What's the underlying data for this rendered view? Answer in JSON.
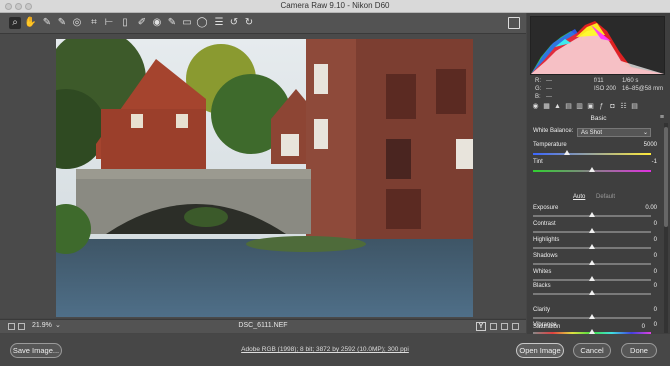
{
  "window": {
    "title": "Camera Raw 9.10  -  Nikon D60"
  },
  "toolbar": {
    "tools": [
      "zoom-tool-icon",
      "hand-tool-icon",
      "white-balance-tool-icon",
      "color-sampler-icon",
      "targeted-adjustment-icon",
      "crop-tool-icon",
      "straighten-tool-icon",
      "spot-removal-icon",
      "red-eye-icon",
      "adjustment-brush-icon",
      "graduated-filter-icon",
      "radial-filter-icon",
      "preferences-icon",
      "rotate-left-icon",
      "rotate-right-icon"
    ],
    "glyphs": [
      "⌕",
      "✋",
      "✎",
      "✎",
      "◎",
      "⌗",
      "⊢",
      "✐",
      "◉",
      "✎",
      "▭",
      "◯",
      "☰",
      "↺",
      "↻"
    ]
  },
  "histogram": {
    "colors": {
      "red": "#ff2020",
      "green": "#30ff30",
      "blue": "#3060ff",
      "yellow": "#ffff20",
      "magenta": "#ff30ff",
      "cyan": "#30ffff",
      "white": "#ffffff"
    }
  },
  "readout": {
    "r_label": "R:",
    "g_label": "G:",
    "b_label": "B:",
    "r_val": "---",
    "g_val": "---",
    "b_val": "---",
    "aperture": "f/11",
    "shutter": "1/60 s",
    "iso": "ISO 200",
    "lens": "16–85@58 mm"
  },
  "panel": {
    "title": "Basic",
    "wb_label": "White Balance:",
    "wb_value": "As Shot",
    "temperature_label": "Temperature",
    "temperature_value": "5000",
    "tint_label": "Tint",
    "tint_value": "-1",
    "auto_label": "Auto",
    "default_label": "Default",
    "exposure_label": "Exposure",
    "exposure_value": "0.00",
    "contrast_label": "Contrast",
    "contrast_value": "0",
    "highlights_label": "Highlights",
    "highlights_value": "0",
    "shadows_label": "Shadows",
    "shadows_value": "0",
    "whites_label": "Whites",
    "whites_value": "0",
    "blacks_label": "Blacks",
    "blacks_value": "0",
    "clarity_label": "Clarity",
    "clarity_value": "0",
    "vibrance_label": "Vibrance",
    "vibrance_value": "0",
    "saturation_label": "Saturation",
    "saturation_value": "0"
  },
  "status": {
    "zoom": "21.9%",
    "filename": "DSC_6111.NEF"
  },
  "bottom": {
    "save_label": "Save Image...",
    "workflow": "Adobe RGB (1998); 8 bit; 3872 by 2592 (10.0MP); 300 ppi",
    "open_label": "Open Image",
    "cancel_label": "Cancel",
    "done_label": "Done"
  }
}
